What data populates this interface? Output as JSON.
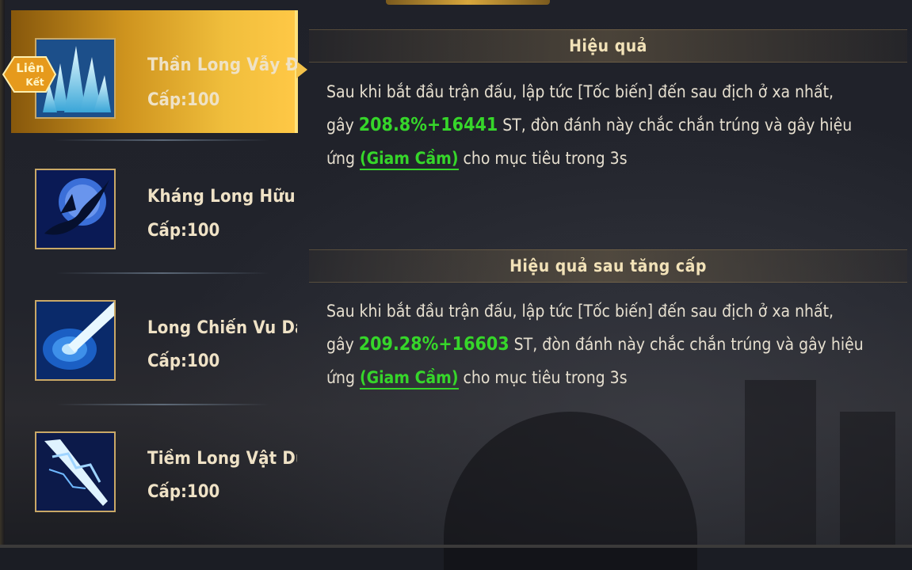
{
  "skills": [
    {
      "name": "Thần Long Vẫy Đuôi",
      "level": "Cấp:100",
      "badge": [
        "Liên",
        "Kết"
      ],
      "selected": true,
      "icon": "ice-crystal-icon"
    },
    {
      "name": "Kháng Long Hữu Hối",
      "level": "Cấp:100",
      "selected": false,
      "icon": "dragon-moon-icon"
    },
    {
      "name": "Long Chiến Vu Dã",
      "level": "Cấp:100",
      "selected": false,
      "icon": "blue-vortex-icon"
    },
    {
      "name": "Tiềm Long Vật Dụng",
      "level": "Cấp:100",
      "selected": false,
      "icon": "lightning-spear-icon"
    }
  ],
  "effect": {
    "title": "Hiệu quả",
    "line1": "Sau khi bắt đầu trận đấu, lập tức [Tốc biến] đến sau địch ở xa nhất,",
    "line2_prefix": "gây ",
    "damage": "208.8%+16441",
    "line2_suffix": " ST, đòn đánh này chắc chắn trúng và gây hiệu",
    "line3_prefix": "ứng ",
    "keyword": "(Giam Cầm)",
    "line3_suffix": " cho mục tiêu trong 3s"
  },
  "upgrade": {
    "title": "Hiệu quả sau tăng cấp",
    "line1": "Sau khi bắt đầu trận đấu, lập tức [Tốc biến] đến sau địch ở xa nhất,",
    "line2_prefix": "gây ",
    "damage": "209.28%+16603",
    "line2_suffix": " ST, đòn đánh này chắc chắn trúng và gây hiệu",
    "line3_prefix": "ứng ",
    "keyword": "(Giam Cầm)",
    "line3_suffix": " cho mục tiêu trong 3s"
  },
  "colors": {
    "highlight": "#36d62a",
    "selected_gold": "#f0be3c",
    "frame_gold": "#c9a867"
  }
}
